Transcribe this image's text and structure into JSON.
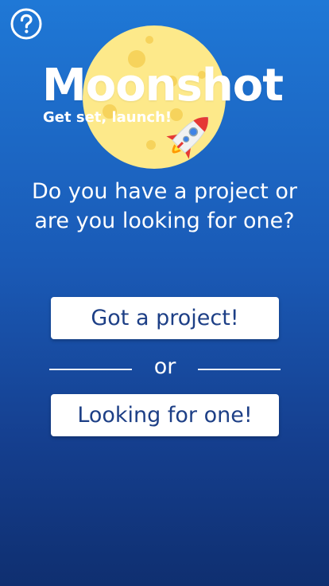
{
  "header": {
    "help_icon": "question-circle-icon",
    "help_label": "?"
  },
  "brand": {
    "title": "Moonshot",
    "subtitle": "Get set, launch!",
    "moon_icon": "moon-icon",
    "rocket_icon": "rocket-icon"
  },
  "prompt": {
    "question": "Do you have a project or are you looking for one?"
  },
  "choices": {
    "project_label": "Got a project!",
    "or_label": "or",
    "looking_label": "Looking for one!"
  },
  "colors": {
    "background_top": "#1f78d6",
    "background_bottom": "#0f2f70",
    "moon": "#fde98a",
    "moon_craters": "#f6d35c",
    "button_bg": "#ffffff",
    "button_text": "#1d3f86",
    "rocket_fins": "#e53935"
  }
}
